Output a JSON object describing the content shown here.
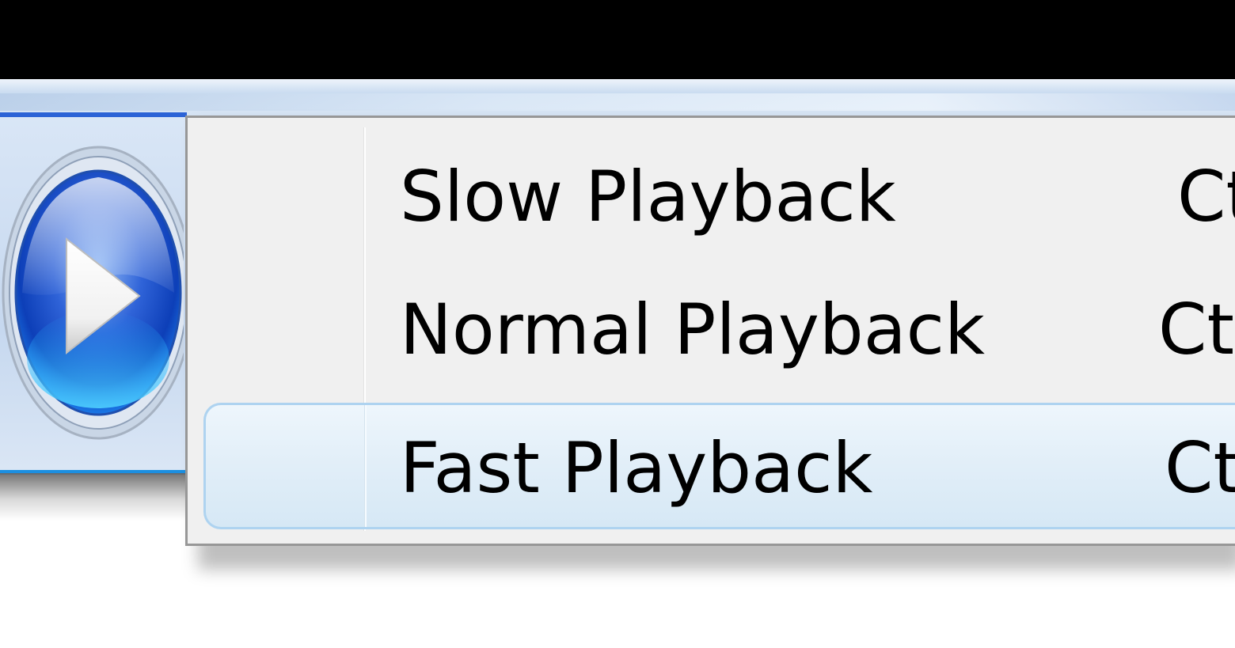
{
  "menu": {
    "items": [
      {
        "label": "Slow Playback",
        "shortcut": "Ct"
      },
      {
        "label": "Normal Playback",
        "shortcut": "Ct"
      },
      {
        "label": "Fast Playback",
        "shortcut": "Ct",
        "highlighted": true
      }
    ]
  },
  "icons": {
    "play": "play-icon"
  },
  "colors": {
    "accent": "#2c63d6",
    "highlight_border": "#aed3f0",
    "menu_background": "#f0f0f0"
  }
}
